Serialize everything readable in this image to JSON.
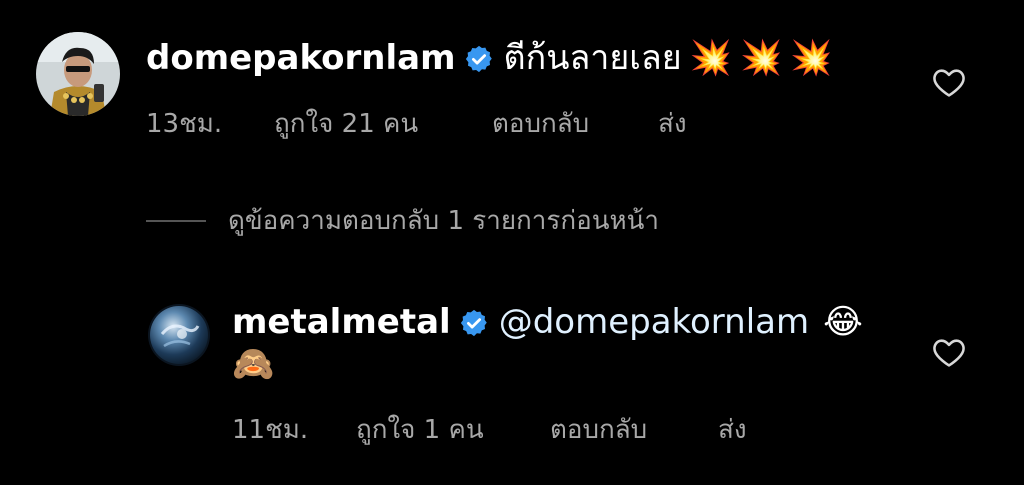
{
  "comments": [
    {
      "username": "domepakornlam",
      "text": "ตีก้นลายเลย",
      "emojis": [
        "💥",
        "💥",
        "💥"
      ],
      "time": "13ชม.",
      "likes": "ถูกใจ 21 คน",
      "reply_label": "ตอบกลับ",
      "send_label": "ส่ง"
    },
    {
      "username": "metalmetal",
      "mention": "@domepakornlam",
      "emojis": [
        "😂",
        "🙈"
      ],
      "time": "11ชม.",
      "likes": "ถูกใจ 1 คน",
      "reply_label": "ตอบกลับ",
      "send_label": "ส่ง"
    }
  ],
  "view_replies": "ดูข้อความตอบกลับ 1 รายการก่อนหน้า",
  "icons": {
    "verified": "verified-badge-icon",
    "heart": "heart-outline-icon"
  },
  "colors": {
    "background": "#000000",
    "verified": "#3897f0",
    "muted": "#a8a8a8",
    "mention": "#e0f1ff"
  }
}
